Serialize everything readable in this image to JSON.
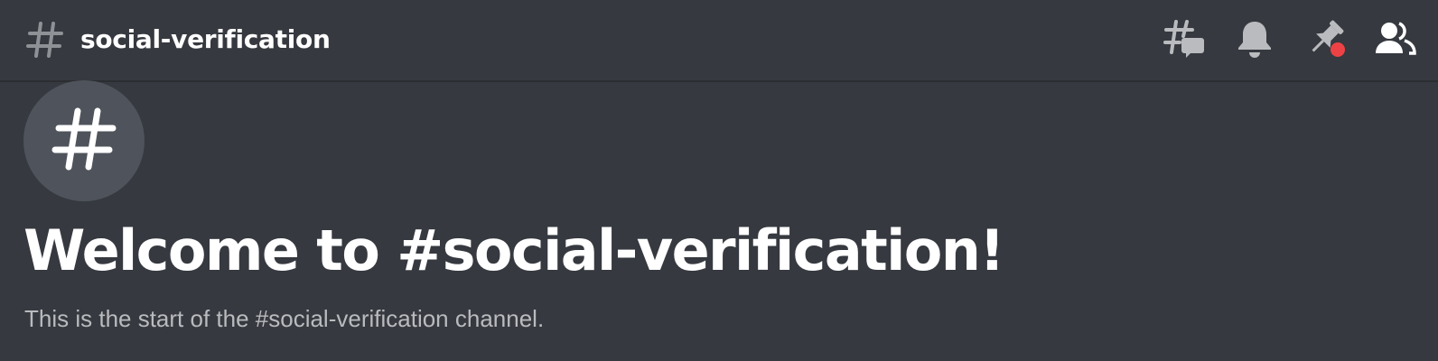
{
  "header": {
    "channel_name": "social-verification",
    "channel_icon": "hash-icon",
    "toolbar": [
      {
        "name": "threads-icon"
      },
      {
        "name": "notification-bell-icon"
      },
      {
        "name": "pinned-messages-icon",
        "badge_color": "#ed4245"
      },
      {
        "name": "member-list-icon"
      }
    ]
  },
  "main": {
    "avatar_icon": "hash-icon",
    "welcome_title": "Welcome to #social-verification!",
    "welcome_subtitle": "This is the start of the #social-verification channel."
  },
  "colors": {
    "background": "#36393f",
    "avatar_bg": "#4f545c",
    "muted_text": "#b9bbbe",
    "icon": "#b9bbbe",
    "badge": "#ed4245"
  }
}
